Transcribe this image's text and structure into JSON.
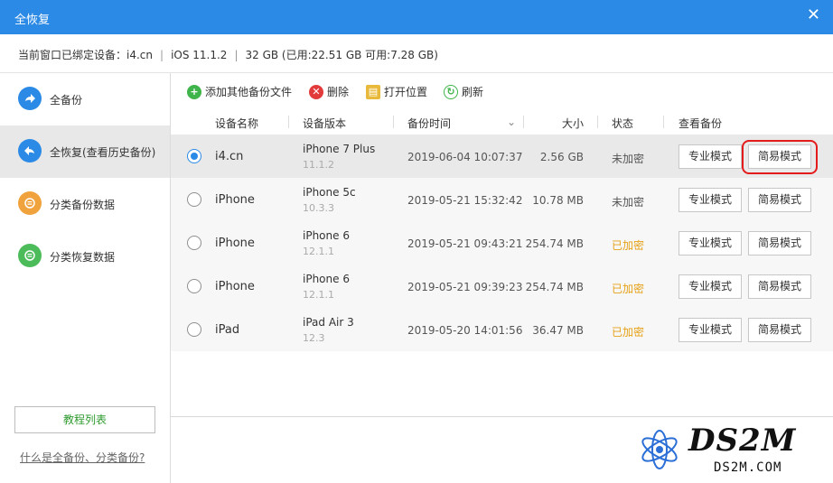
{
  "window": {
    "title": "全恢复",
    "close_glyph": "✕"
  },
  "info": {
    "label": "当前窗口已绑定设备：",
    "device": "i4.cn",
    "ios": "iOS 11.1.2",
    "storage": "32 GB (已用:22.51 GB 可用:7.28 GB)",
    "separator": "|"
  },
  "sidebar": {
    "items": [
      {
        "label": "全备份",
        "icon": "arrow-right-icon",
        "glyph": "➜",
        "color": "#2b8ae6",
        "active": false
      },
      {
        "label": "全恢复(查看历史备份)",
        "icon": "arrow-left-icon",
        "glyph": "↶",
        "color": "#2b8ae6",
        "active": true
      },
      {
        "label": "分类备份数据",
        "icon": "category-backup-icon",
        "glyph": "☰",
        "color": "#f0a23c",
        "active": false
      },
      {
        "label": "分类恢复数据",
        "icon": "category-restore-icon",
        "glyph": "☰",
        "color": "#4cbb5a",
        "active": false
      }
    ],
    "tutorial_button": "教程列表",
    "help_link": "什么是全备份、分类备份?"
  },
  "toolbar": {
    "add": {
      "label": "添加其他备份文件",
      "glyph": "+",
      "color": "#3fb44a"
    },
    "delete": {
      "label": "删除",
      "glyph": "✕",
      "color": "#e23b3b"
    },
    "open": {
      "label": "打开位置",
      "glyph": "▤",
      "color": "#e8b93a"
    },
    "refresh": {
      "label": "刷新",
      "glyph": "↻",
      "color": "#3fb44a"
    }
  },
  "table": {
    "headers": {
      "name": "设备名称",
      "version": "设备版本",
      "time": "备份时间",
      "size": "大小",
      "status": "状态",
      "view": "查看备份",
      "sort_glyph": "⌄"
    },
    "rows": [
      {
        "name": "i4.cn",
        "model": "iPhone 7 Plus",
        "ios": "11.1.2",
        "time": "2019-06-04 10:07:37",
        "size": "2.56 GB",
        "status": "未加密",
        "encrypted": false,
        "selected": true,
        "pro": "专业模式",
        "easy": "简易模式"
      },
      {
        "name": "iPhone",
        "model": "iPhone 5c",
        "ios": "10.3.3",
        "time": "2019-05-21 15:32:42",
        "size": "10.78 MB",
        "status": "未加密",
        "encrypted": false,
        "selected": false,
        "pro": "专业模式",
        "easy": "简易模式"
      },
      {
        "name": "iPhone",
        "model": "iPhone 6",
        "ios": "12.1.1",
        "time": "2019-05-21 09:43:21",
        "size": "254.74 MB",
        "status": "已加密",
        "encrypted": true,
        "selected": false,
        "pro": "专业模式",
        "easy": "简易模式"
      },
      {
        "name": "iPhone",
        "model": "iPhone 6",
        "ios": "12.1.1",
        "time": "2019-05-21 09:39:23",
        "size": "254.74 MB",
        "status": "已加密",
        "encrypted": true,
        "selected": false,
        "pro": "专业模式",
        "easy": "简易模式"
      },
      {
        "name": "iPad",
        "model": "iPad Air 3",
        "ios": "12.3",
        "time": "2019-05-20 14:01:56",
        "size": "36.47 MB",
        "status": "已加密",
        "encrypted": true,
        "selected": false,
        "pro": "专业模式",
        "easy": "简易模式"
      }
    ]
  },
  "watermark": {
    "logo": "DS2M",
    "url": "DS2M.COM"
  },
  "colors": {
    "accent": "#2b8ae6",
    "encrypted": "#e6a118",
    "highlight": "#e31b1b"
  }
}
